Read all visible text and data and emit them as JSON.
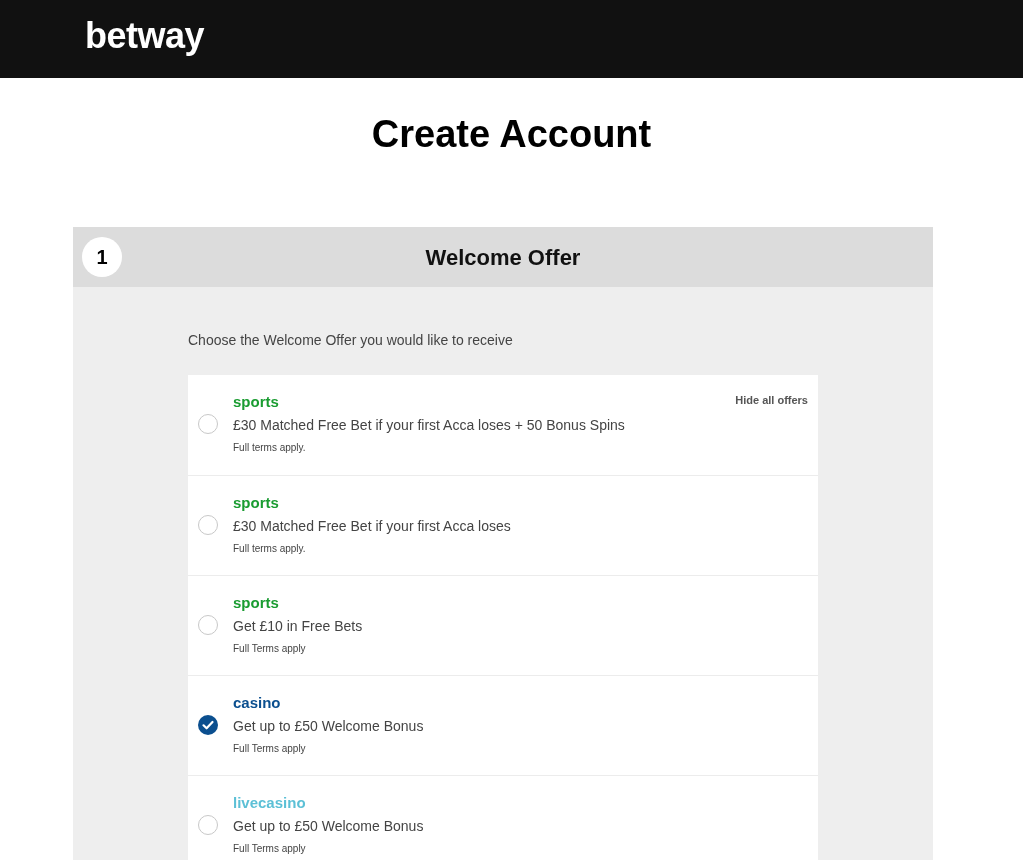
{
  "header": {
    "logo": "betway"
  },
  "page_title": "Create Account",
  "step": {
    "number": "1",
    "title": "Welcome Offer"
  },
  "intro": "Choose the Welcome Offer you would like to receive",
  "offers": {
    "hide_link": "Hide all offers",
    "items": [
      {
        "category": "sports",
        "color": "#1a9c31",
        "offer": "£30 Matched Free Bet if your first Acca loses + 50 Bonus Spins",
        "terms": "Full terms apply.",
        "selected": false
      },
      {
        "category": "sports",
        "color": "#1a9c31",
        "offer": "£30 Matched Free Bet if your first Acca loses",
        "terms": "Full terms apply.",
        "selected": false
      },
      {
        "category": "sports",
        "color": "#1a9c31",
        "offer": "Get £10 in Free Bets",
        "terms": "Full Terms apply",
        "selected": false
      },
      {
        "category": "casino",
        "color": "#0b4f8f",
        "offer": "Get up to £50 Welcome Bonus",
        "terms": "Full Terms apply",
        "selected": true
      },
      {
        "category": "livecasino",
        "color": "#5cc0d6",
        "offer": "Get up to £50 Welcome Bonus",
        "terms": "Full Terms apply",
        "selected": false
      }
    ]
  }
}
